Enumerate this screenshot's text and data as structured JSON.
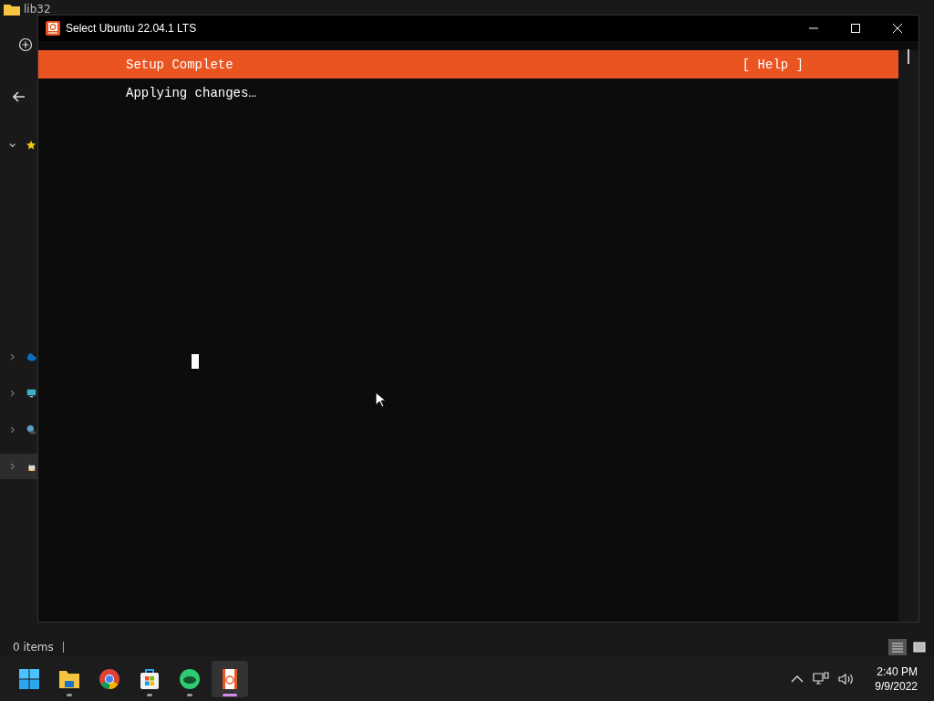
{
  "explorer": {
    "folder_title": "lib32",
    "status_text": "0 items",
    "sidebar": [
      {
        "expanded": true,
        "selected": false
      },
      {
        "expanded": false,
        "selected": false
      },
      {
        "expanded": false,
        "selected": false
      },
      {
        "expanded": false,
        "selected": false
      },
      {
        "expanded": false,
        "selected": true
      }
    ],
    "view_buttons": [
      {
        "selected": true
      },
      {
        "selected": false
      }
    ]
  },
  "window": {
    "title": "Select Ubuntu 22.04.1 LTS"
  },
  "terminal": {
    "header": "Setup Complete",
    "help": "[ Help ]",
    "lines": [
      "Applying changes…"
    ],
    "cursor": true
  },
  "taskbar": {
    "apps": [
      {
        "kind": "start",
        "running": false,
        "selected": false
      },
      {
        "kind": "folder",
        "running": true,
        "selected": false
      },
      {
        "kind": "browser",
        "running": false,
        "selected": false
      },
      {
        "kind": "store",
        "running": true,
        "selected": false
      },
      {
        "kind": "green",
        "running": true,
        "selected": false
      },
      {
        "kind": "ubuntu",
        "running": true,
        "selected": true
      }
    ],
    "time": "2:40 PM",
    "date": "9/9/2022"
  }
}
